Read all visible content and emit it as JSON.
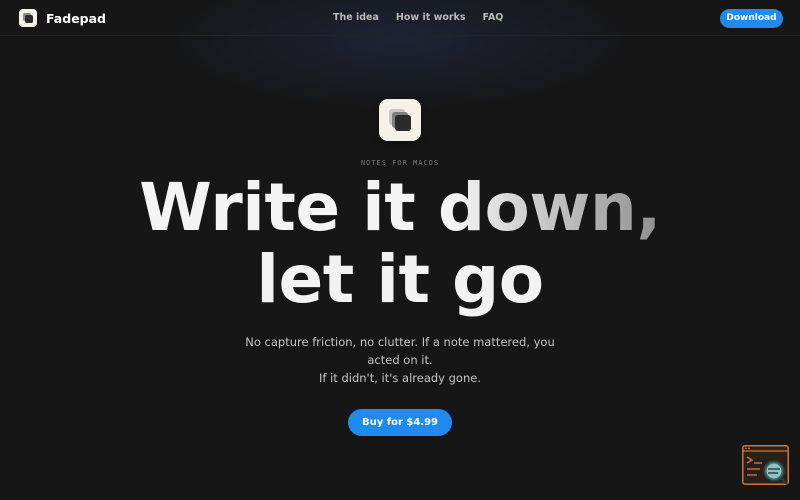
{
  "app": {
    "name": "Fadepad",
    "logo_icon": "fadepad-logo-icon"
  },
  "nav": {
    "links": [
      {
        "label": "The idea"
      },
      {
        "label": "How it works"
      },
      {
        "label": "FAQ"
      }
    ],
    "download_label": "Download"
  },
  "hero": {
    "icon": "fadepad-app-icon",
    "eyebrow": "NOTES FOR MACOS",
    "headline_line1": "Write it down,",
    "headline_line2": "let it go",
    "subtext_line1": "No capture friction, no clutter. If a note mattered, you acted on it.",
    "subtext_line2": "If it didn't, it's already gone.",
    "cta_label": "Buy for $4.99"
  },
  "widget": {
    "icon": "terminal-search-icon"
  },
  "colors": {
    "background": "#161616",
    "accent": "#1f8bf0",
    "text": "#f2f2f2"
  }
}
